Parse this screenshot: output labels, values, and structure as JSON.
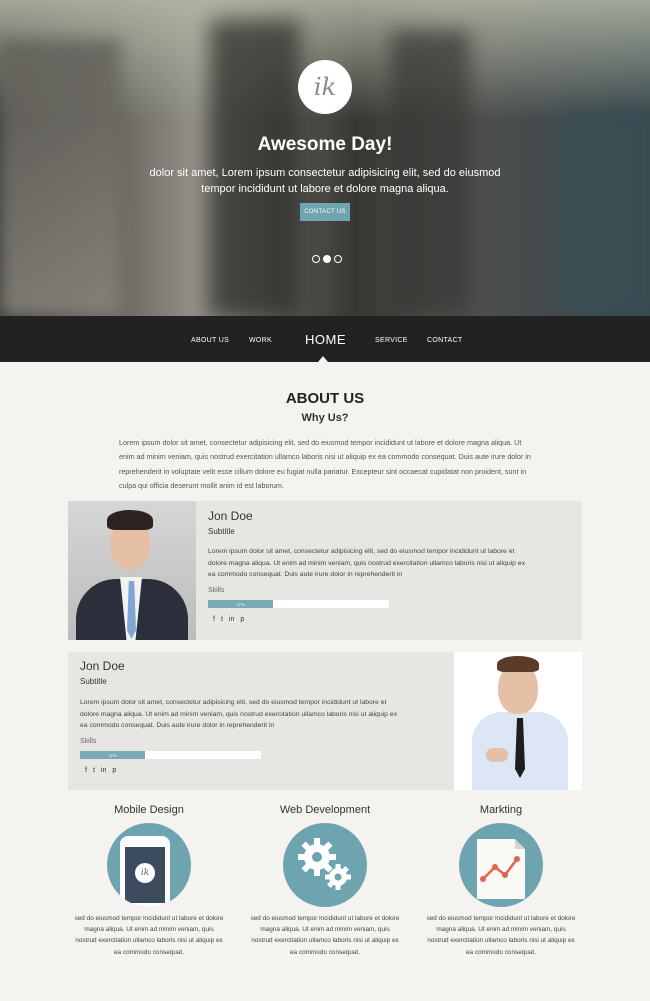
{
  "hero": {
    "logo_text": "ik",
    "title": "Awesome Day!",
    "text": "dolor sit amet, Lorem ipsum consectetur adipisicing elit, sed do eiusmod tempor incididunt ut labore et dolore magna aliqua.",
    "button_label": "CONTACT US",
    "slide_count": 3,
    "active_slide": 2
  },
  "nav": {
    "items": [
      "ABOUT US",
      "WORK",
      "HOME",
      "SERVICE",
      "CONTACT"
    ],
    "active": "HOME"
  },
  "about": {
    "title": "ABOUT US",
    "subtitle": "Why Us?",
    "text": "Lorem ipsum dolor sit amet, consectetur adipisicing elit, sed do eiusmod tempor incididunt ut labore et dolore magna aliqua. Ut enim ad minim veniam, quis nostrud exercitation ullamco laboris nisi ut aliquip ex ea commodo consequat. Duis aute irure dolor in reprehenderit in voluptate velit esse cillum dolore eu fugiat nulla pariatur. Excepteur sint occaecat cupidatat non proident, sunt in culpa qui officia deserunt mollit anim id est laborum."
  },
  "team": [
    {
      "name": "Jon Doe",
      "subtitle": "Subtitle",
      "bio": "Lorem ipsum dolor sit amet, consectetur adipisicing elit, sed do eiusmod tempor incididunt ut labore et dolore magna aliqua. Ut enim ad minim veniam, quis nostrud exercitation ullamco laboris nisi ut aliquip ex ea commodo consequat. Duis aute irure dolor in reprehenderit in",
      "skills_label": "Skills",
      "skill_percent": 36,
      "skill_text": "37%",
      "social": [
        "f",
        "t",
        "in",
        "p"
      ]
    },
    {
      "name": "Jon Doe",
      "subtitle": "Subtitle",
      "bio": "Lorem ipsum dolor sit amet, consectetur adipisicing elit, sed do eiusmod tempor incididunt ut labore et dolore magna aliqua. Ut enim ad minim veniam, quis nostrud exercitation ullamco laboris nisi ut aliquip ex ea commodo consequat. Duis aute irure dolor in reprehenderit in",
      "skills_label": "Skills",
      "skill_percent": 36,
      "skill_text": "37%",
      "social": [
        "f",
        "t",
        "in",
        "p"
      ]
    }
  ],
  "services": [
    {
      "title": "Mobile Design",
      "icon": "phone-icon",
      "text": "sed do eiusmod tempor incididunt ut labore et dolore magna aliqua. Ut enim ad minim veniam, quis nostrud exercitation ullamco laboris nisi ut aliquip ex ea commodo consequat."
    },
    {
      "title": "Web Development",
      "icon": "gears-icon",
      "text": "sed do eiusmod tempor incididunt ut labore et dolore magna aliqua. Ut enim ad minim veniam, quis nostrud exercitation ullamco laboris nisi ut aliquip ex ea commodo consequat."
    },
    {
      "title": "Markting",
      "icon": "chart-document-icon",
      "text": "sed do eiusmod tempor incididunt ut labore et dolore magna aliqua. Ut enim ad minim veniam, quis nostrud exercitation ullamco laboris nisi ut aliquip ex ea commodo consequat."
    }
  ],
  "colors": {
    "accent": "#6fa5b1",
    "nav_bg": "#222222",
    "page_bg": "#f4f3ef",
    "card_bg": "#e7e6e2"
  }
}
